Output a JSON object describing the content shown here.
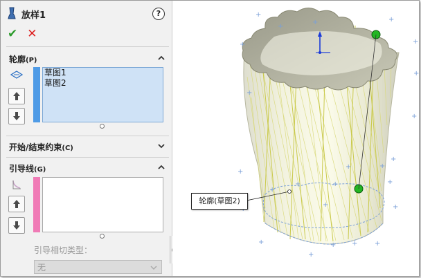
{
  "feature": {
    "title": "放样1",
    "help_label": "?"
  },
  "actions": {
    "ok_symbol": "✔",
    "cancel_symbol": "✕"
  },
  "sections": {
    "profiles": {
      "label": "轮廓",
      "suffix": "(P)",
      "items": [
        "草图1",
        "草图2"
      ]
    },
    "start_end": {
      "label": "开始/结束约束",
      "suffix": "(C)"
    },
    "guides": {
      "label": "引导线",
      "suffix": "(G)",
      "tangency_label": "引导相切类型：",
      "tangency_value": "无"
    }
  },
  "viewport": {
    "callout_label": "轮廓(草图2)"
  },
  "colors": {
    "profile_bar": "#4f9be6",
    "guide_bar": "#f07bb6",
    "ok": "#2d9c2d",
    "cancel": "#dd2222"
  }
}
